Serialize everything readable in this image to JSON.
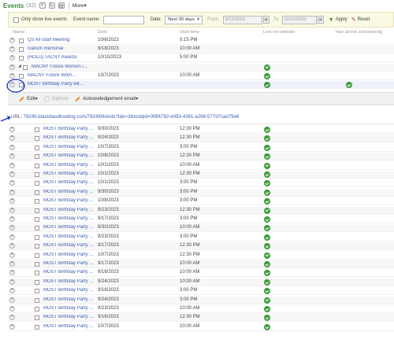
{
  "header": {
    "title": "Events",
    "count": "(32)",
    "more": "More"
  },
  "filter": {
    "only_live": "Only show live events",
    "event_name_label": "Event name:",
    "date_label": "Date:",
    "date_value": "Next 30 days",
    "from_label": "From:",
    "from_value": "9/12/2023",
    "to_label": "To:",
    "to_value": "10/12/2023",
    "apply": "Apply",
    "reset": "Reset"
  },
  "columns": {
    "name": "Name",
    "date": "Date",
    "start": "Start time",
    "live": "Live on website",
    "ack": "Has active acknowledg"
  },
  "top_rows": [
    {
      "name": "Q3 All-Staff Meeting",
      "date": "10/6/2023",
      "start": "5:15 PM",
      "live": false,
      "expander": ""
    },
    {
      "name": "Galson memorial",
      "date": "9/18/2023",
      "start": "10:00 AM",
      "live": false,
      "expander": ""
    },
    {
      "name": "[HOLD] TACNY Awards",
      "date": "10/10/2023",
      "start": "5:00 PM",
      "live": false,
      "expander": ""
    },
    {
      "name": "MACNY Future Women i...",
      "date": "",
      "start": "",
      "live": true,
      "expander": "+"
    },
    {
      "name": "MACNY Future Wom...",
      "date": "10/7/2023",
      "start": "10:00 AM",
      "live": true,
      "expander": ""
    },
    {
      "name": "MOST Birthday Party wit...",
      "date": "",
      "start": "",
      "live": true,
      "ack": true,
      "expander": ""
    }
  ],
  "toolbar": {
    "edit": "Edit",
    "options": "Options",
    "ack_email": "Acknowledgement email"
  },
  "url": {
    "label": "URL:",
    "value": "79249.blackbaudhosting.com/79249/tickets?tab=3&txobjid=0f9f4792-e093-4391-a266-577d7cad79e6"
  },
  "child_rows": [
    {
      "name": "MOST Birthday Party ...",
      "date": "9/30/2023",
      "start": "12:30 PM"
    },
    {
      "name": "MOST Birthday Party ...",
      "date": "9/24/2023",
      "start": "12:30 PM"
    },
    {
      "name": "MOST Birthday Party ...",
      "date": "10/7/2023",
      "start": "3:00 PM"
    },
    {
      "name": "MOST Birthday Party ...",
      "date": "10/8/2023",
      "start": "12:30 PM"
    },
    {
      "name": "MOST Birthday Party ...",
      "date": "10/1/2023",
      "start": "10:00 AM"
    },
    {
      "name": "MOST Birthday Party ...",
      "date": "10/1/2023",
      "start": "12:30 PM"
    },
    {
      "name": "MOST Birthday Party ...",
      "date": "10/1/2023",
      "start": "3:00 PM"
    },
    {
      "name": "MOST Birthday Party ...",
      "date": "9/30/2023",
      "start": "3:00 PM"
    },
    {
      "name": "MOST Birthday Party ...",
      "date": "10/8/2023",
      "start": "3:00 PM"
    },
    {
      "name": "MOST Birthday Party ...",
      "date": "9/23/2023",
      "start": "12:30 PM"
    },
    {
      "name": "MOST Birthday Party ...",
      "date": "9/17/2023",
      "start": "3:00 PM"
    },
    {
      "name": "MOST Birthday Party ...",
      "date": "9/30/2023",
      "start": "10:00 AM"
    },
    {
      "name": "MOST Birthday Party ...",
      "date": "9/23/2023",
      "start": "3:00 PM"
    },
    {
      "name": "MOST Birthday Party ...",
      "date": "9/17/2023",
      "start": "12:30 PM"
    },
    {
      "name": "MOST Birthday Party ...",
      "date": "10/7/2023",
      "start": "12:30 PM"
    },
    {
      "name": "MOST Birthday Party ...",
      "date": "9/17/2023",
      "start": "10:00 AM"
    },
    {
      "name": "MOST Birthday Party ...",
      "date": "9/16/2023",
      "start": "10:00 AM"
    },
    {
      "name": "MOST Birthday Party ...",
      "date": "9/24/2023",
      "start": "10:00 AM"
    },
    {
      "name": "MOST Birthday Party ...",
      "date": "9/16/2023",
      "start": "3:00 PM"
    },
    {
      "name": "MOST Birthday Party ...",
      "date": "9/24/2023",
      "start": "3:00 PM"
    },
    {
      "name": "MOST Birthday Party ...",
      "date": "9/23/2023",
      "start": "10:00 AM"
    },
    {
      "name": "MOST Birthday Party ...",
      "date": "9/16/2023",
      "start": "12:30 PM"
    },
    {
      "name": "MOST Birthday Party ...",
      "date": "10/7/2023",
      "start": "10:00 AM"
    }
  ],
  "colors": {
    "title_green": "#3a8a3a",
    "link_blue": "#3c5fb0",
    "live_green": "#3c9a3c",
    "filter_bg": "#f9f9e4",
    "annotation_blue": "#1a2fb0"
  }
}
